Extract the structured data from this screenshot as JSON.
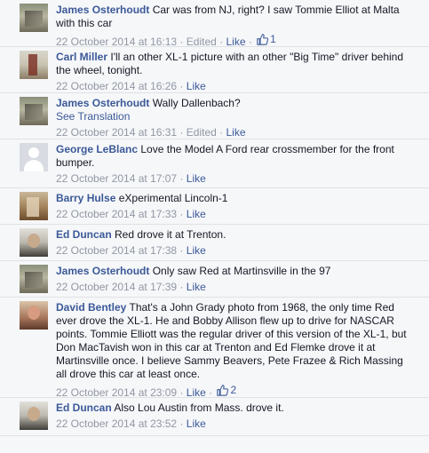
{
  "comments": [
    {
      "author": "James Osterhoudt",
      "text": "Car was from NJ, right? I saw Tommie Elliot at Malta with this car",
      "time": "22 October 2014 at 16:13",
      "edited": "Edited",
      "like": "Like",
      "likes": "1",
      "avatar": "photo1"
    },
    {
      "author": "Carl Miller",
      "text": "I'll an other XL-1 picture with an other \"Big Time\" driver behind the wheel, tonight.",
      "time": "22 October 2014 at 16:26",
      "like": "Like",
      "avatar": "photo2"
    },
    {
      "author": "James Osterhoudt",
      "text": "Wally Dallenbach?",
      "translate": "See Translation",
      "time": "22 October 2014 at 16:31",
      "edited": "Edited",
      "like": "Like",
      "avatar": "photo1"
    },
    {
      "author": "George LeBlanc",
      "text": "Love the Model A Ford rear crossmember for the front bumper.",
      "time": "22 October 2014 at 17:07",
      "like": "Like",
      "avatar": "blank"
    },
    {
      "author": "Barry Hulse",
      "text": "eXperimental Lincoln-1",
      "time": "22 October 2014 at 17:33",
      "like": "Like",
      "avatar": "photo3"
    },
    {
      "author": "Ed Duncan",
      "text": "Red drove it at Trenton.",
      "time": "22 October 2014 at 17:38",
      "like": "Like",
      "avatar": "photo4"
    },
    {
      "author": "James Osterhoudt",
      "text": "Only saw Red at Martinsville in the 97",
      "time": "22 October 2014 at 17:39",
      "like": "Like",
      "avatar": "photo1"
    },
    {
      "author": "David Bentley",
      "text": "That's a John Grady photo from 1968, the only time Red ever drove the XL-1. He and Bobby Allison flew up to drive for NASCAR points. Tommie Elliott was the regular driver of this version of the XL-1, but Don MacTavish won in this car at Trenton and Ed Flemke drove it at Martinsville once. I believe Sammy Beavers, Pete Frazee & Rich Massing all drove this car at least once.",
      "time": "22 October 2014 at 23:09",
      "like": "Like",
      "likes": "2",
      "avatar": "photo5"
    },
    {
      "author": "Ed Duncan",
      "text": "Also Lou Austin from Mass. drove it.",
      "time": "22 October 2014 at 23:52",
      "like": "Like",
      "avatar": "photo4"
    }
  ],
  "separator": " · ",
  "colors": {
    "link": "#3b5998",
    "meta": "#9197a3",
    "background": "#f6f7f9",
    "border": "#e1e2e3"
  }
}
